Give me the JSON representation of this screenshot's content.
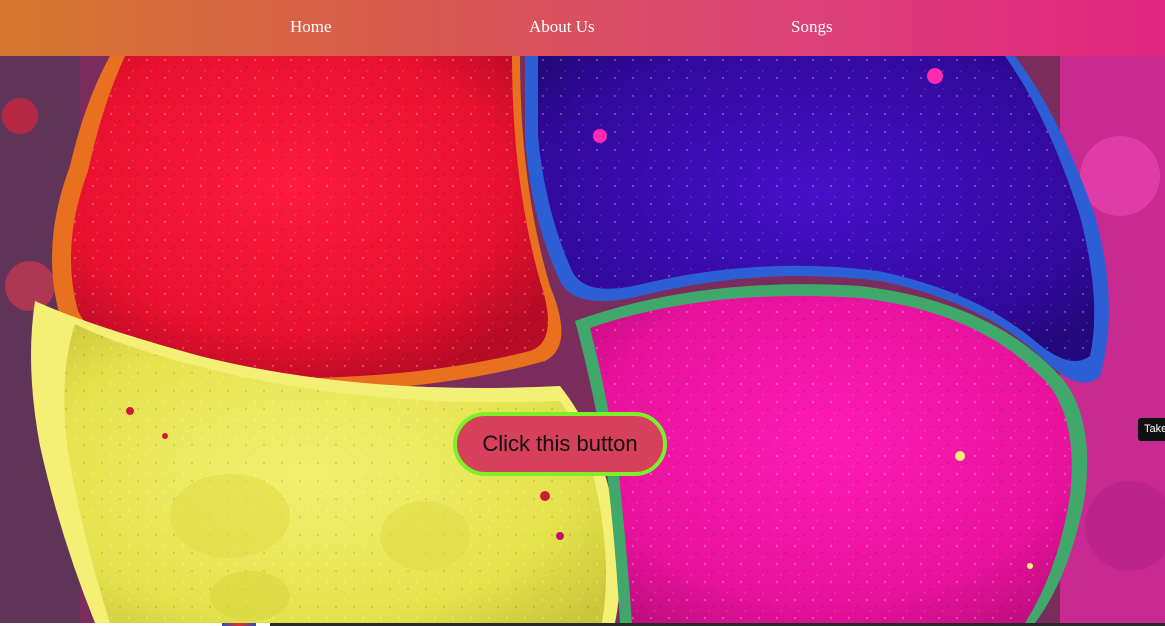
{
  "nav": {
    "items": [
      {
        "label": "Home"
      },
      {
        "label": "About Us"
      },
      {
        "label": "Songs"
      }
    ]
  },
  "hero": {
    "button_label": "Click this button",
    "tooltip_text": "Take"
  },
  "colors": {
    "nav_gradient_start": "#d6762e",
    "nav_gradient_end": "#e0257f",
    "button_fill": "#d6405b",
    "button_border": "#7cf028",
    "powder_red": "#f0123a",
    "powder_blue": "#3a10b8",
    "powder_yellow": "#e8e84a",
    "powder_pink": "#f21aa8"
  }
}
